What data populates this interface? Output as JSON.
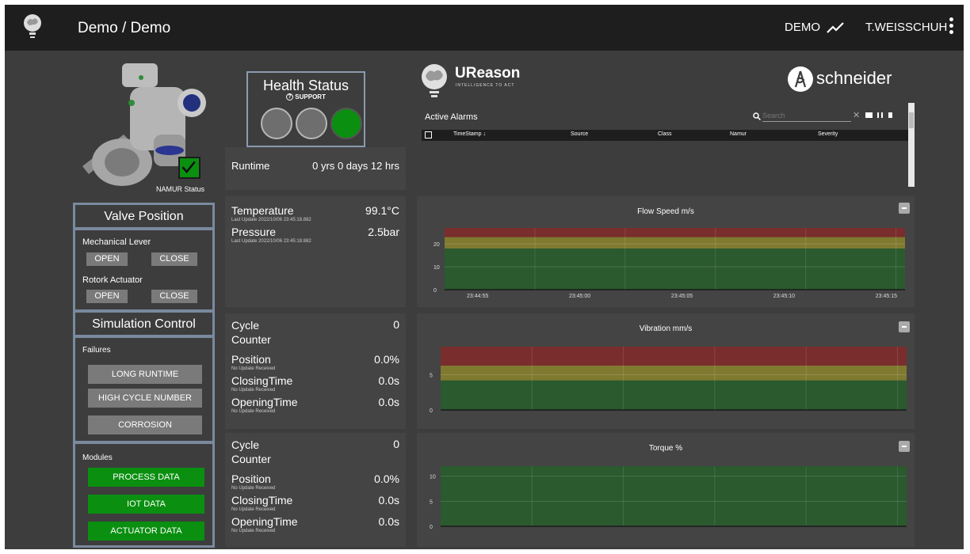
{
  "header": {
    "title": "Demo / Demo",
    "demo_label": "DEMO",
    "user": "T.WEISSCHUH"
  },
  "equipment": {
    "namur_label": "NAMUR Status"
  },
  "health": {
    "title": "Health Status",
    "support_label": "SUPPORT",
    "lights": [
      "grey",
      "grey",
      "green"
    ]
  },
  "runtime": {
    "label": "Runtime",
    "value": "0 yrs 0 days 12 hrs"
  },
  "process": {
    "temperature_label": "Temperature",
    "temperature_value": "99.1°C",
    "temperature_update": "Last Update 2022/10/06 23:45:18.882",
    "pressure_label": "Pressure",
    "pressure_value": "2.5bar",
    "pressure_update": "Last Update 2022/10/06 23:45:18.882"
  },
  "valve": {
    "title": "Valve Position",
    "mechanical_label": "Mechanical Lever",
    "rotork_label": "Rotork Actuator",
    "open_label": "OPEN",
    "close_label": "CLOSE"
  },
  "simulation": {
    "title": "Simulation Control",
    "failures_label": "Failures",
    "failures": [
      "LONG RUNTIME",
      "HIGH CYCLE NUMBER",
      "CORROSION"
    ],
    "modules_label": "Modules",
    "modules": [
      "PROCESS DATA",
      "IOT DATA",
      "ACTUATOR DATA"
    ]
  },
  "iot_block_1": {
    "cycle_label": "Cycle Counter",
    "cycle_value": "0",
    "position_label": "Position",
    "position_value": "0.0%",
    "position_update": "No Update Received",
    "closing_label": "ClosingTime",
    "closing_value": "0.0s",
    "closing_update": "No Update Received",
    "opening_label": "OpeningTime",
    "opening_value": "0.0s",
    "opening_update": "No Update Received"
  },
  "iot_block_2": {
    "cycle_label": "Cycle Counter",
    "cycle_value": "0",
    "position_label": "Position",
    "position_value": "0.0%",
    "position_update": "No Update Received",
    "closing_label": "ClosingTime",
    "closing_value": "0.0s",
    "closing_update": "No Update Received",
    "opening_label": "OpeningTime",
    "opening_value": "0.0s",
    "opening_update": "No Update Received"
  },
  "brand": {
    "ureason": "UReason",
    "ureason_tag": "INTELLIGENCE TO ACT",
    "schneider": "schneider"
  },
  "alarms": {
    "title": "Active Alarms",
    "search_placeholder": "Search",
    "columns": [
      "TimeStamp ↓",
      "Source",
      "Class",
      "Namur",
      "Severity"
    ],
    "rows": []
  },
  "colors": {
    "band_red": "#7a2d2d",
    "band_yellow": "#7f7a30",
    "band_green": "#2a5a2e",
    "ok_green": "#0a8f10"
  },
  "chart_data": [
    {
      "type": "area",
      "title": "Flow Speed m/s",
      "x": [
        "23:44:55",
        "23:45:00",
        "23:45:05",
        "23:45:10",
        "23:45:15"
      ],
      "yticks": [
        0,
        10,
        20
      ],
      "ylim": [
        0,
        27
      ],
      "bands": [
        {
          "from": 0,
          "to": 18,
          "color": "green"
        },
        {
          "from": 18,
          "to": 23,
          "color": "yellow"
        },
        {
          "from": 23,
          "to": 27,
          "color": "red"
        }
      ],
      "series": []
    },
    {
      "type": "area",
      "title": "Vibration mm/s",
      "x": [],
      "yticks": [
        0,
        5
      ],
      "ylim": [
        0,
        9
      ],
      "bands": [
        {
          "from": 0,
          "to": 4.2,
          "color": "green"
        },
        {
          "from": 4.2,
          "to": 6.3,
          "color": "yellow"
        },
        {
          "from": 6.3,
          "to": 9,
          "color": "red"
        }
      ],
      "series": []
    },
    {
      "type": "area",
      "title": "Torque %",
      "x": [],
      "yticks": [
        0,
        5,
        10
      ],
      "ylim": [
        0,
        12
      ],
      "bands": [
        {
          "from": 0,
          "to": 12,
          "color": "green"
        }
      ],
      "series": []
    }
  ]
}
